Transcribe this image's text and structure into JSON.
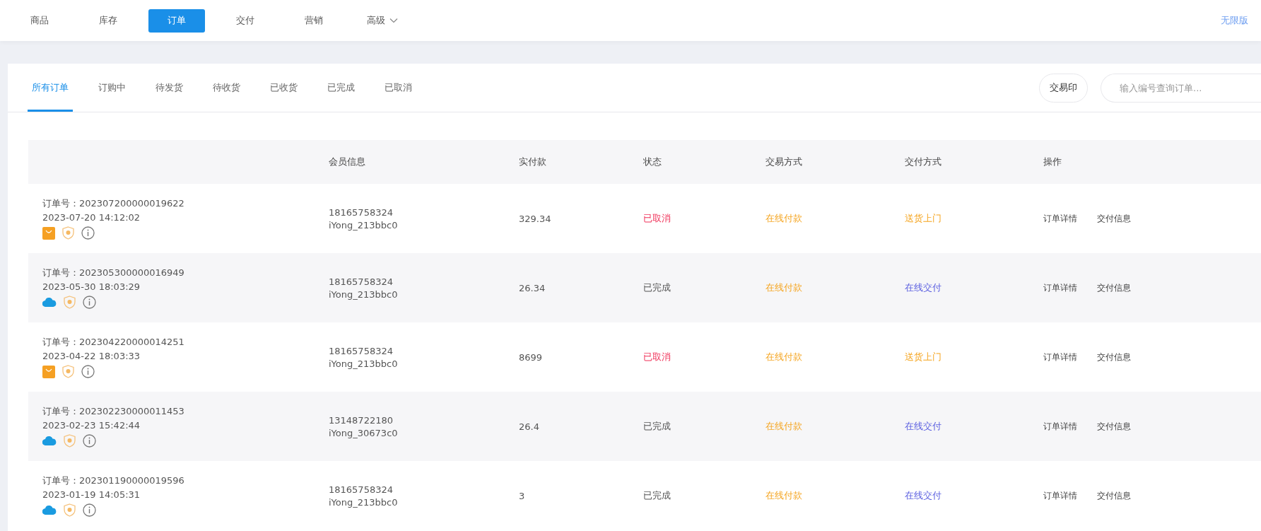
{
  "top_nav": {
    "items": [
      {
        "label": "商品",
        "selected": false,
        "has_menu": false
      },
      {
        "label": "库存",
        "selected": false,
        "has_menu": false
      },
      {
        "label": "订单",
        "selected": true,
        "has_menu": false
      },
      {
        "label": "交付",
        "selected": false,
        "has_menu": false
      },
      {
        "label": "营销",
        "selected": false,
        "has_menu": false
      },
      {
        "label": "高级",
        "selected": false,
        "has_menu": true
      }
    ],
    "edition_link": "无限版"
  },
  "order_tabs": [
    {
      "label": "所有订单",
      "selected": true
    },
    {
      "label": "订购中",
      "selected": false
    },
    {
      "label": "待发货",
      "selected": false
    },
    {
      "label": "待收货",
      "selected": false
    },
    {
      "label": "已收货",
      "selected": false
    },
    {
      "label": "已完成",
      "selected": false
    },
    {
      "label": "已取消",
      "selected": false
    }
  ],
  "print_button": "交易印",
  "search": {
    "placeholder": "输入编号查询订单..."
  },
  "table": {
    "columns": [
      "会员信息",
      "实付款",
      "状态",
      "交易方式",
      "交付方式",
      "操作"
    ],
    "rows": [
      {
        "order_no": "订单号：202307200000019622",
        "time": "2023-07-20 14:12:02",
        "channel": {
          "kind": "bag"
        },
        "phone": "18165758324",
        "member": "iYong_213bbc0",
        "amount": "329.34",
        "status": {
          "text": "已取消",
          "kind": "cancelled"
        },
        "payment": "在线付款",
        "delivery": {
          "text": "送货上门",
          "kind": "home"
        },
        "actions": [
          "订单详情",
          "交付信息"
        ]
      },
      {
        "order_no": "订单号：202305300000016949",
        "time": "2023-05-30 18:03:29",
        "channel": {
          "kind": "cloud"
        },
        "phone": "18165758324",
        "member": "iYong_213bbc0",
        "amount": "26.34",
        "status": {
          "text": "已完成",
          "kind": "completed"
        },
        "payment": "在线付款",
        "delivery": {
          "text": "在线交付",
          "kind": "online"
        },
        "actions": [
          "订单详情",
          "交付信息"
        ]
      },
      {
        "order_no": "订单号：202304220000014251",
        "time": "2023-04-22 18:03:33",
        "channel": {
          "kind": "bag"
        },
        "phone": "18165758324",
        "member": "iYong_213bbc0",
        "amount": "8699",
        "status": {
          "text": "已取消",
          "kind": "cancelled"
        },
        "payment": "在线付款",
        "delivery": {
          "text": "送货上门",
          "kind": "home"
        },
        "actions": [
          "订单详情",
          "交付信息"
        ]
      },
      {
        "order_no": "订单号：202302230000011453",
        "time": "2023-02-23 15:42:44",
        "channel": {
          "kind": "cloud"
        },
        "phone": "13148722180",
        "member": "iYong_30673c0",
        "amount": "26.4",
        "status": {
          "text": "已完成",
          "kind": "completed"
        },
        "payment": "在线付款",
        "delivery": {
          "text": "在线交付",
          "kind": "online"
        },
        "actions": [
          "订单详情",
          "交付信息"
        ]
      },
      {
        "order_no": "订单号：202301190000019596",
        "time": "2023-01-19 14:05:31",
        "channel": {
          "kind": "cloud"
        },
        "phone": "18165758324",
        "member": "iYong_213bbc0",
        "amount": "3",
        "status": {
          "text": "已完成",
          "kind": "completed"
        },
        "payment": "在线付款",
        "delivery": {
          "text": "在线交付",
          "kind": "online"
        },
        "actions": [
          "订单详情",
          "交付信息"
        ]
      }
    ]
  }
}
